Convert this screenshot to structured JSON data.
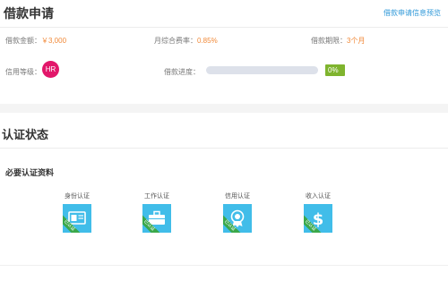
{
  "header": {
    "title": "借款申请",
    "preview_link": "借款申请信息预览"
  },
  "loan_info": {
    "amount_label": "借款金额：",
    "amount_value": "￥3,000",
    "rate_label": "月综合费率：",
    "rate_value": "0.85%",
    "term_label": "借款期限：",
    "term_value": "3个月",
    "grade_label": "信用等级：",
    "grade_value": "HR",
    "progress_label": "借款进度：",
    "progress_percent": 0,
    "progress_text": "0%"
  },
  "auth": {
    "title": "认证状态",
    "subtitle": "必要认证资料",
    "ribbon_text": "已认证",
    "items": [
      {
        "label": "身份认证",
        "icon": "id-card-icon"
      },
      {
        "label": "工作认证",
        "icon": "briefcase-icon"
      },
      {
        "label": "信用认证",
        "icon": "credit-seal-icon"
      },
      {
        "label": "收入认证",
        "icon": "dollar-icon"
      }
    ]
  },
  "colors": {
    "accent_blue": "#41bde9",
    "link_blue": "#2f98d8",
    "value_orange": "#f18a3a",
    "badge_pink": "#e2176a",
    "progress_green": "#7fb42e"
  }
}
